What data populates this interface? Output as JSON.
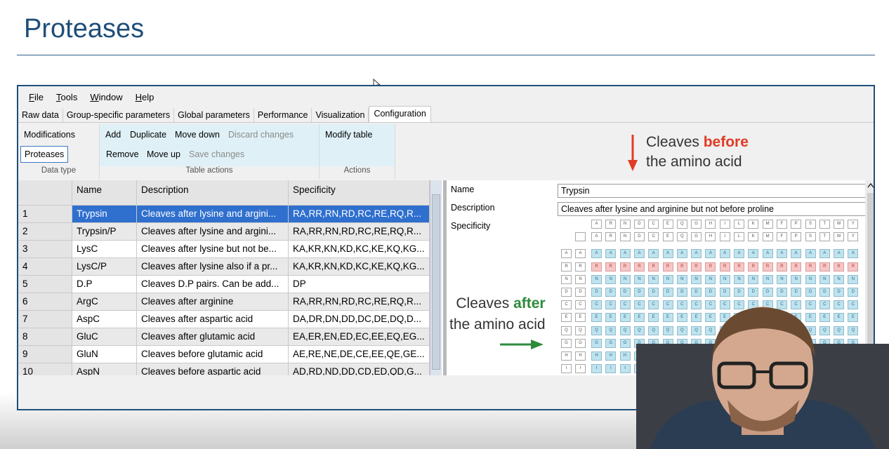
{
  "slide": {
    "title": "Proteases"
  },
  "menu": [
    {
      "label": "File",
      "mnemonic": "F",
      "rest": "ile"
    },
    {
      "label": "Tools",
      "mnemonic": "T",
      "rest": "ools"
    },
    {
      "label": "Window",
      "mnemonic": "W",
      "rest": "indow"
    },
    {
      "label": "Help",
      "mnemonic": "H",
      "rest": "elp"
    }
  ],
  "tabs": [
    "Raw data",
    "Group-specific parameters",
    "Global parameters",
    "Performance",
    "Visualization",
    "Configuration"
  ],
  "active_tab": "Configuration",
  "ribbon": {
    "data_type": {
      "modifications": "Modifications",
      "proteases": "Proteases",
      "label": "Data type"
    },
    "table_actions": {
      "add": "Add",
      "duplicate": "Duplicate",
      "move_down": "Move down",
      "discard": "Discard changes",
      "remove": "Remove",
      "move_up": "Move up",
      "save": "Save changes",
      "label": "Table actions"
    },
    "actions": {
      "modify_table": "Modify table",
      "label": "Actions"
    }
  },
  "table": {
    "headers": [
      "Name",
      "Description",
      "Specificity"
    ],
    "rows": [
      {
        "num": "1",
        "name": "Trypsin",
        "description": "Cleaves after lysine and argini...",
        "specificity": "RA,RR,RN,RD,RC,RE,RQ,R..."
      },
      {
        "num": "2",
        "name": "Trypsin/P",
        "description": "Cleaves after lysine and argini...",
        "specificity": "RA,RR,RN,RD,RC,RE,RQ,R..."
      },
      {
        "num": "3",
        "name": "LysC",
        "description": "Cleaves after lysine but not be...",
        "specificity": "KA,KR,KN,KD,KC,KE,KQ,KG..."
      },
      {
        "num": "4",
        "name": "LysC/P",
        "description": "Cleaves after lysine also if a pr...",
        "specificity": "KA,KR,KN,KD,KC,KE,KQ,KG..."
      },
      {
        "num": "5",
        "name": "D.P",
        "description": "Cleaves D.P pairs. Can be add...",
        "specificity": "DP"
      },
      {
        "num": "6",
        "name": "ArgC",
        "description": "Cleaves after arginine",
        "specificity": "RA,RR,RN,RD,RC,RE,RQ,R..."
      },
      {
        "num": "7",
        "name": "AspC",
        "description": "Cleaves after aspartic acid",
        "specificity": "DA,DR,DN,DD,DC,DE,DQ,D..."
      },
      {
        "num": "8",
        "name": "GluC",
        "description": "Cleaves after glutamic acid",
        "specificity": "EA,ER,EN,ED,EC,EE,EQ,EG..."
      },
      {
        "num": "9",
        "name": "GluN",
        "description": "Cleaves before glutamic acid",
        "specificity": "AE,RE,NE,DE,CE,EE,QE,GE..."
      },
      {
        "num": "10",
        "name": "AspN",
        "description": "Cleaves before aspartic acid",
        "specificity": "AD,RD,ND,DD,CD,ED,QD,G..."
      }
    ]
  },
  "detail": {
    "name_label": "Name",
    "name_value": "Trypsin",
    "description_label": "Description",
    "description_value": "Cleaves after lysine and arginine but not before proline",
    "specificity_label": "Specificity",
    "amino_acids": [
      "A",
      "R",
      "N",
      "D",
      "C",
      "E",
      "Q",
      "G",
      "H",
      "I",
      "L",
      "K",
      "M",
      "F",
      "P",
      "S",
      "T",
      "W",
      "Y"
    ],
    "row_acids": [
      "A",
      "R",
      "N",
      "D",
      "C",
      "E",
      "Q",
      "G",
      "H",
      "I"
    ]
  },
  "annotations": {
    "before_prefix": "Cleaves ",
    "before_bold": "before",
    "before_line2": "the amino acid",
    "after_prefix": "Cleaves ",
    "after_bold": "after",
    "after_line2": "the amino acid",
    "before_color": "#e03b24",
    "after_color": "#2e8b3c"
  }
}
